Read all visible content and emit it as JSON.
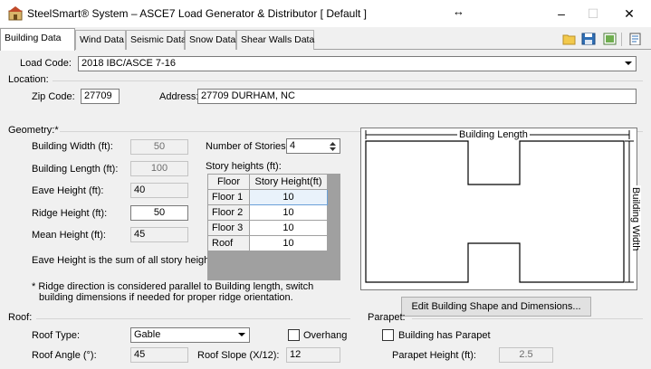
{
  "window": {
    "title": "SteelSmart® System – ASCE7 Load Generator & Distributor [ Default ]",
    "minimize": "–",
    "maximize": "☐",
    "close": "✕",
    "resize_cursor": "↔"
  },
  "tabs": [
    {
      "label": "Building Data",
      "active": true
    },
    {
      "label": "Wind Data"
    },
    {
      "label": "Seismic Data"
    },
    {
      "label": "Snow Data"
    },
    {
      "label": "Shear Walls Data"
    }
  ],
  "load_code": {
    "label": "Load Code:",
    "value": "2018 IBC/ASCE 7-16"
  },
  "location": {
    "group_label": "Location:",
    "zip_label": "Zip Code:",
    "zip_value": "27709",
    "address_label": "Address:",
    "address_value": "27709 DURHAM, NC"
  },
  "geometry": {
    "group_label": "Geometry:*",
    "building_width_label": "Building Width (ft):",
    "building_width_value": "50",
    "building_length_label": "Building Length (ft):",
    "building_length_value": "100",
    "eave_height_label": "Eave Height (ft):",
    "eave_height_value": "40",
    "ridge_height_label": "Ridge Height (ft):",
    "ridge_height_value": "50",
    "mean_height_label": "Mean Height (ft):",
    "mean_height_value": "45",
    "eave_note": "Eave Height is the sum of all story heights",
    "stories_label": "Number of Stories:",
    "stories_value": "4",
    "story_heights_label": "Story heights (ft):",
    "table_headers": [
      "Floor",
      "Story Height(ft)"
    ],
    "table_rows": [
      {
        "floor": "Floor 1",
        "height": "10"
      },
      {
        "floor": "Floor 2",
        "height": "10"
      },
      {
        "floor": "Floor 3",
        "height": "10"
      },
      {
        "floor": "Roof",
        "height": "10"
      }
    ],
    "ridge_note_line1": "*  Ridge direction is considered parallel to Building length, switch",
    "ridge_note_line2": "building dimensions if needed for proper ridge orientation."
  },
  "diagram": {
    "length_label": "Building Length",
    "width_label": "Building Width",
    "edit_button": "Edit Building Shape and Dimensions..."
  },
  "roof": {
    "group_label": "Roof:",
    "type_label": "Roof Type:",
    "type_value": "Gable",
    "overhang_label": "Overhang",
    "overhang_checked": false,
    "angle_label": "Roof Angle (°):",
    "angle_value": "45",
    "slope_label": "Roof Slope (X/12):",
    "slope_value": "12"
  },
  "parapet": {
    "group_label": "Parapet:",
    "has_parapet_label": "Building has Parapet",
    "has_parapet_checked": false,
    "height_label": "Parapet Height (ft):",
    "height_value": "2.5"
  },
  "colors": {
    "accent": "#0078d7",
    "diagram_line": "#000000",
    "scrollbar_gray": "#a0a0a0"
  }
}
